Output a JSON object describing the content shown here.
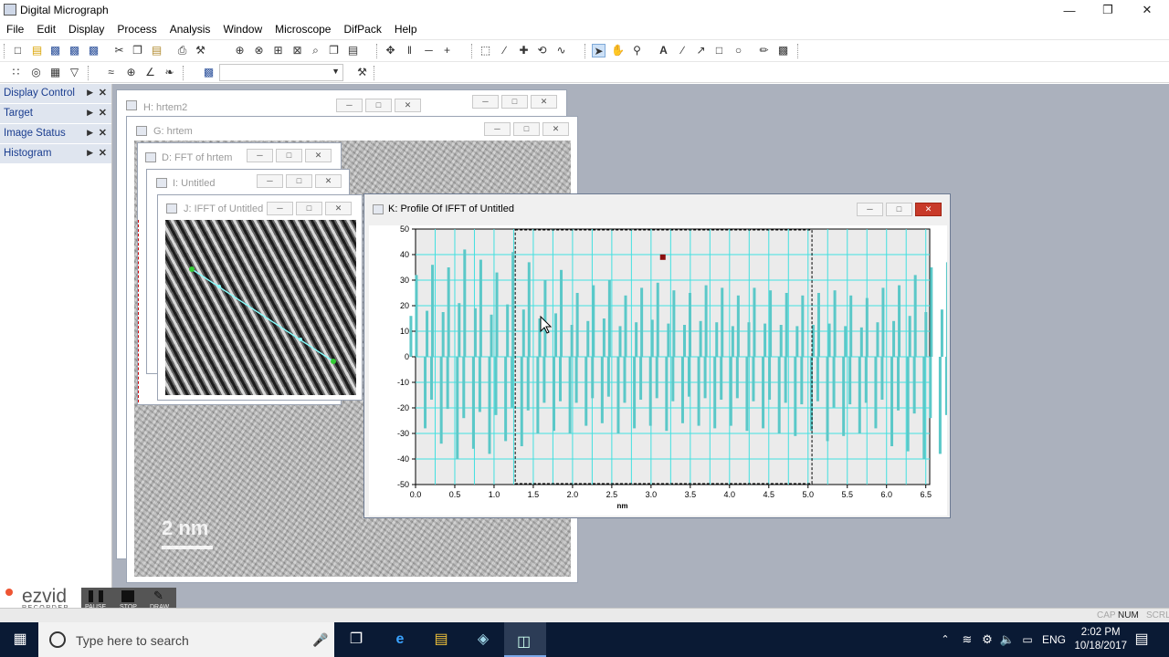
{
  "app": {
    "title": "Digital Micrograph"
  },
  "menu": [
    "File",
    "Edit",
    "Display",
    "Process",
    "Analysis",
    "Window",
    "Microscope",
    "DifPack",
    "Help"
  ],
  "sidebar": {
    "items": [
      {
        "label": "Display Control"
      },
      {
        "label": "Target"
      },
      {
        "label": "Image Status"
      },
      {
        "label": "Histogram"
      }
    ]
  },
  "windows": {
    "h": {
      "title": "H: hrtem2"
    },
    "g": {
      "title": "G: hrtem"
    },
    "d": {
      "title": "D: FFT of hrtem"
    },
    "i": {
      "title": "I: Untitled"
    },
    "j": {
      "title": "J: IFFT of Untitled"
    },
    "k": {
      "title": "K: Profile Of IFFT of Untitled"
    }
  },
  "scale_bar": {
    "label": "2 nm"
  },
  "chart_data": {
    "type": "bar",
    "title": "",
    "xlabel": "nm",
    "ylabel": "",
    "xlim": [
      0,
      6.55
    ],
    "ylim": [
      -50,
      50
    ],
    "x_ticks": [
      "0.0",
      "0.5",
      "1.0",
      "1.5",
      "2.0",
      "2.5",
      "3.0",
      "3.5",
      "4.0",
      "4.5",
      "5.0",
      "5.5",
      "6.0",
      "6.5"
    ],
    "y_ticks": [
      "50",
      "40",
      "30",
      "20",
      "10",
      "0",
      "-10",
      "-20",
      "-30",
      "-40",
      "-50"
    ],
    "grid": true,
    "series_color": "#5bc8c8",
    "grid_color": "#42e0e0",
    "selection_nm": [
      1.27,
      5.05
    ],
    "marker": {
      "x": 3.15,
      "y": 39
    },
    "period_nm": 0.205,
    "peaks_pos": [
      32,
      36,
      35,
      42,
      38,
      33,
      41,
      37,
      30,
      34,
      25,
      28,
      30,
      24,
      27,
      29,
      26,
      25,
      28,
      27,
      24,
      27,
      26,
      25,
      24,
      25,
      26,
      24,
      23,
      27,
      28,
      32,
      35,
      37,
      40,
      43,
      38,
      41
    ],
    "peaks_neg": [
      -28,
      -34,
      -40,
      -36,
      -38,
      -33,
      -35,
      -30,
      -29,
      -30,
      -27,
      -26,
      -30,
      -28,
      -27,
      -29,
      -26,
      -27,
      -28,
      -27,
      -29,
      -28,
      -30,
      -31,
      -29,
      -33,
      -31,
      -30,
      -28,
      -35,
      -37,
      -40,
      -38,
      -42,
      -39,
      -38,
      -40,
      -36
    ]
  },
  "ezvid": {
    "brand": "ezvid",
    "sub": "RECORDER",
    "pause": "PAUSE",
    "stop": "STOP",
    "draw": "DRAW"
  },
  "status": {
    "cap": "CAP",
    "num": "NUM",
    "scrl": "SCRL"
  },
  "taskbar": {
    "search_placeholder": "Type here to search",
    "time": "2:02 PM",
    "date": "10/18/2017",
    "lang": "ENG"
  }
}
